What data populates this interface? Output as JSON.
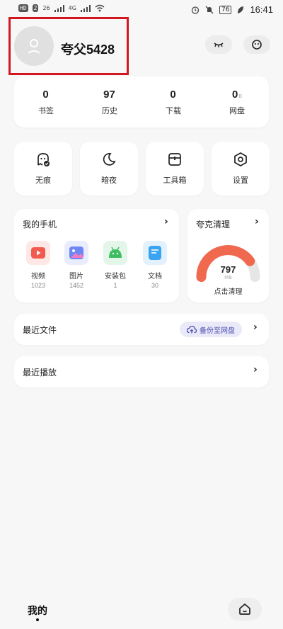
{
  "status_bar": {
    "badges": [
      "HD",
      "2"
    ],
    "net_1": "26",
    "net_2": "4G",
    "battery": "76",
    "time": "16:41"
  },
  "profile": {
    "username": "夸父5428"
  },
  "stats": [
    {
      "value": "0",
      "unit": "",
      "label": "书签"
    },
    {
      "value": "97",
      "unit": "",
      "label": "历史"
    },
    {
      "value": "0",
      "unit": "",
      "label": "下载"
    },
    {
      "value": "0",
      "unit": "B",
      "label": "网盘"
    }
  ],
  "tools": [
    {
      "label": "无痕"
    },
    {
      "label": "暗夜"
    },
    {
      "label": "工具箱"
    },
    {
      "label": "设置"
    }
  ],
  "my_phone": {
    "title": "我的手机",
    "items": [
      {
        "name": "视频",
        "count": "1023",
        "color": "#f25a4d"
      },
      {
        "name": "图片",
        "count": "1452",
        "color": "#6e86f2"
      },
      {
        "name": "安装包",
        "count": "1",
        "color": "#3fbd62"
      },
      {
        "name": "文档",
        "count": "30",
        "color": "#3aa4f0"
      }
    ]
  },
  "cleaner": {
    "title": "夸克清理",
    "value": "797",
    "unit": "MB",
    "action": "点击清理",
    "accent": "#f0694f",
    "used_fraction": 0.8
  },
  "recent_files": {
    "title": "最近文件",
    "backup_label": "备份至网盘"
  },
  "recent_play": {
    "title": "最近播放"
  },
  "bottom": {
    "title": "我的"
  }
}
